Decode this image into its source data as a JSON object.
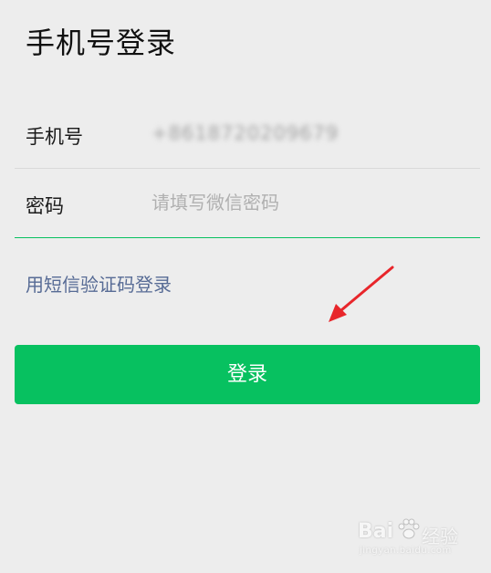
{
  "header": {
    "title": "手机号登录"
  },
  "form": {
    "phone": {
      "label": "手机号",
      "value": "+8618720209679"
    },
    "password": {
      "label": "密码",
      "placeholder": "请填写微信密码"
    }
  },
  "links": {
    "sms_login": "用短信验证码登录"
  },
  "actions": {
    "login_label": "登录"
  },
  "annotation": {
    "arrow_color": "#e8262b"
  },
  "watermark": {
    "brand": "Bai",
    "brand_suffix": "经验",
    "url": "jingyan.baidu.com"
  },
  "colors": {
    "accent": "#07c160",
    "link": "#576b95",
    "background": "#ededed"
  }
}
